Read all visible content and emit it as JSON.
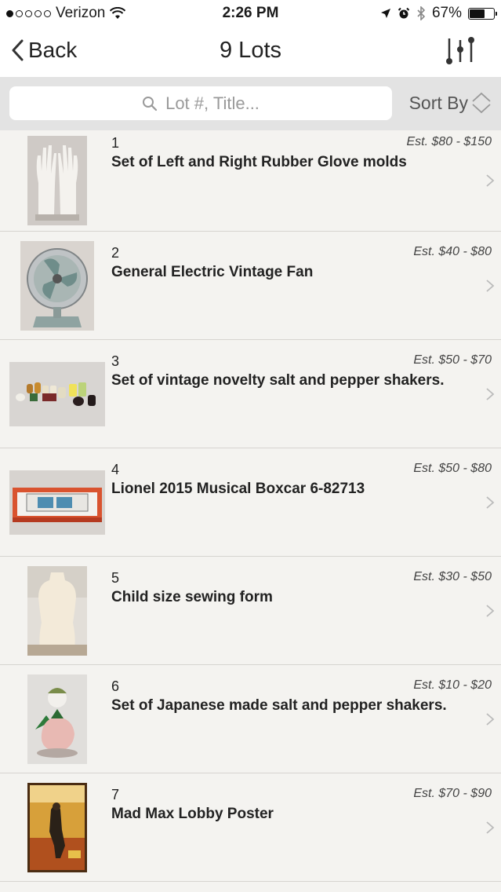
{
  "status": {
    "carrier": "Verizon",
    "time": "2:26 PM",
    "battery": "67%",
    "battery_level": 0.67,
    "signal_bars_filled": 1,
    "signal_bars_total": 5
  },
  "nav": {
    "back_label": "Back",
    "title": "9 Lots"
  },
  "search": {
    "placeholder": "Lot #, Title..."
  },
  "sort": {
    "label": "Sort By"
  },
  "lots": [
    {
      "number": "1",
      "title": "Set of Left and Right Rubber Glove molds",
      "estimate": "Est. $80 - $150"
    },
    {
      "number": "2",
      "title": "General Electric Vintage Fan",
      "estimate": "Est. $40 - $80"
    },
    {
      "number": "3",
      "title": "Set of vintage novelty salt and pepper shakers.",
      "estimate": "Est. $50 - $70"
    },
    {
      "number": "4",
      "title": "Lionel 2015 Musical Boxcar 6-82713",
      "estimate": "Est. $50 - $80"
    },
    {
      "number": "5",
      "title": "Child size sewing form",
      "estimate": "Est. $30 - $50"
    },
    {
      "number": "6",
      "title": "Set of Japanese made salt and pepper shakers.",
      "estimate": "Est. $10 - $20"
    },
    {
      "number": "7",
      "title": "Mad Max Lobby Poster",
      "estimate": "Est. $70 - $90"
    }
  ],
  "colors": {
    "background": "#f4f3f0",
    "search_bar_bg": "#e3e3e3",
    "divider": "#d6d4d0"
  }
}
